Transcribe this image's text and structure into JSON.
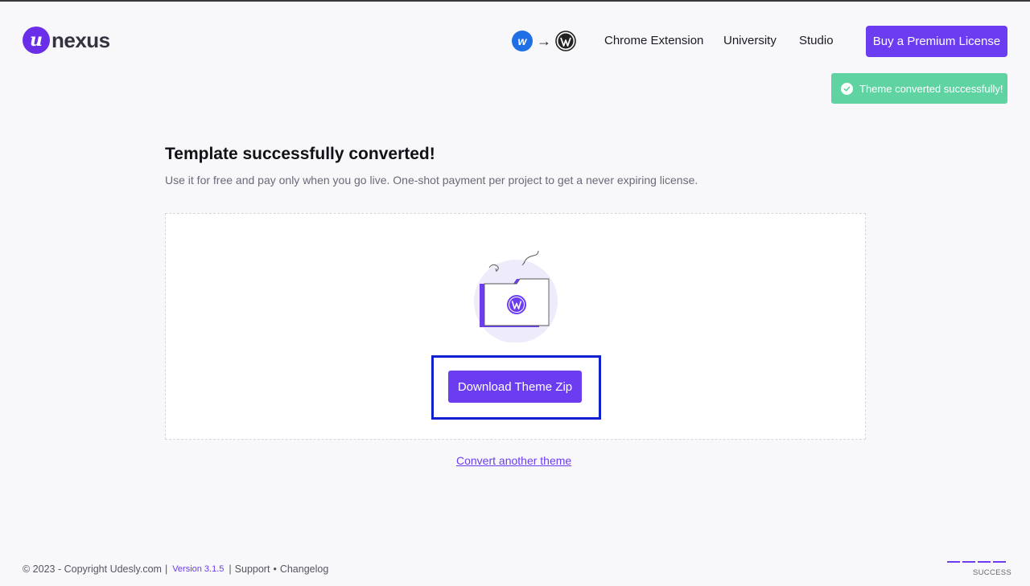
{
  "header": {
    "logo_letter": "u",
    "logo_text": "nexus",
    "converter": {
      "from_icon": "webflow-icon",
      "arrow": "→",
      "to_icon": "wordpress-icon",
      "from_letter": "w"
    },
    "nav": [
      "Chrome Extension",
      "University",
      "Studio"
    ],
    "premium_label": "Buy a Premium License"
  },
  "toast": {
    "message": "Theme converted successfully!",
    "icon": "check-circle-icon",
    "color": "#5fd3a2"
  },
  "main": {
    "title": "Template successfully converted!",
    "subtitle": "Use it for free and pay only when you go live. One-shot payment per project to get a never expiring license.",
    "illustration_icon": "wordpress-folder-icon",
    "download_label": "Download Theme Zip",
    "convert_link": "Convert another theme"
  },
  "footer": {
    "copyright": "© 2023 - Copyright Udesly.com",
    "divider": "|",
    "version": "Version 3.1.5",
    "support": "Support",
    "dot": "•",
    "changelog": "Changelog"
  },
  "progress": {
    "steps_completed": 4,
    "steps_total": 4,
    "label": "SUCCESS"
  },
  "colors": {
    "accent": "#6b3cf0",
    "focus_frame": "#1020d0",
    "background": "#f8f8fa"
  }
}
